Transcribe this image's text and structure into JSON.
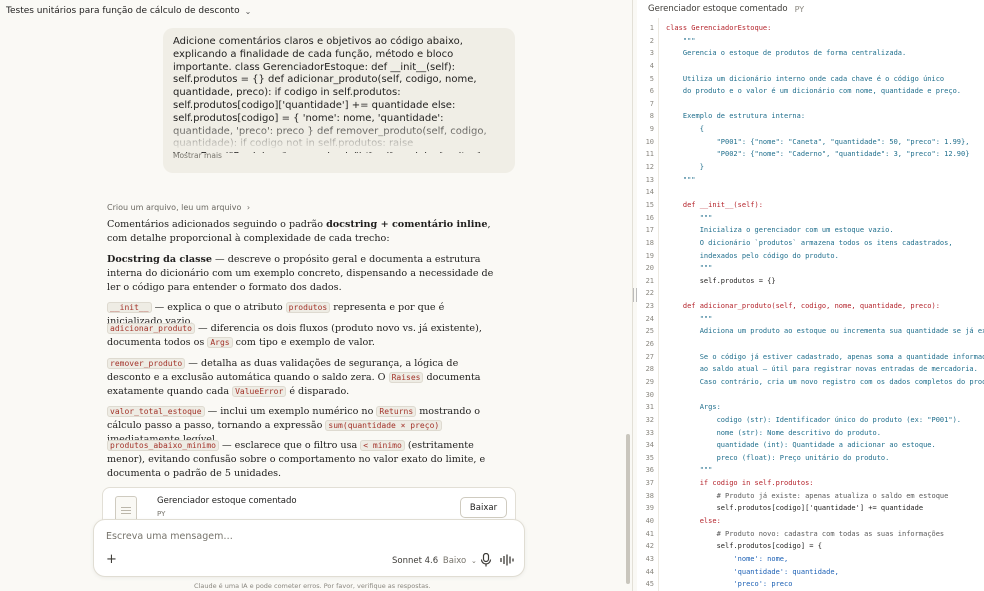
{
  "chat": {
    "title": "Testes unitários para função de cálculo de desconto",
    "user_message": "Adicione comentários claros e objetivos ao código abaixo, explicando a finalidade de cada função, método e bloco importante. class GerenciadorEstoque: def __init__(self): self.produtos = {} def adicionar_produto(self, codigo, nome, quantidade, preco): if codigo in self.produtos: self.produtos[codigo]['quantidade'] += quantidade else: self.produtos[codigo] = { 'nome': nome, 'quantidade': quantidade, 'preco': preco } def remover_produto(self, codigo, quantidade): if codigo not in self.produtos: raise ValueError(\"Produto não encontrado\") if self.produtos[codigo]['quantidade'] < quantidade: raise ValueError(\"Estoque",
    "show_more": "Mostrar mais",
    "activity": "Criou um arquivo, leu um arquivo",
    "intro_pre": "Comentários adicionados seguindo o padrão ",
    "intro_bold": "docstring + comentário inline",
    "intro_post": ", com detalhe proporcional à complexidade de cada trecho:",
    "p1_bold": "Docstring da classe",
    "p1_rest": " — descreve o propósito geral e documenta a estrutura interna do dicionário com um exemplo concreto, dispensando a necessidade de ler o código para entender o formato dos dados.",
    "p2_code": "__init__",
    "p2_mid": " — explica o que o atributo ",
    "p2_code2": "produtos",
    "p2_rest": " representa e por que é inicializado vazio.",
    "p3_code": "adicionar_produto",
    "p3_mid": " — diferencia os dois fluxos (produto novo vs. já existente), documenta todos os ",
    "p3_code2": "Args",
    "p3_rest": " com tipo e exemplo de valor.",
    "p4_code": "remover_produto",
    "p4_mid": " — detalha as duas validações de segurança, a lógica de desconto e a exclusão automática quando o saldo zera. O ",
    "p4_code2": "Raises",
    "p4_mid2": " documenta exatamente quando cada ",
    "p4_code3": "ValueError",
    "p4_rest": " é disparado.",
    "p5_code": "valor_total_estoque",
    "p5_mid": " — inclui um exemplo numérico no ",
    "p5_code2": "Returns",
    "p5_mid2": " mostrando o cálculo passo a passo, tornando a expressão ",
    "p5_code3": "sum(quantidade × preço)",
    "p5_rest": " imediatamente legível.",
    "p6_code": "produtos_abaixo_minimo",
    "p6_mid": " — esclarece que o filtro usa ",
    "p6_code2": "< minimo",
    "p6_rest": " (estritamente menor), evitando confusão sobre o comportamento no valor exato do limite, e documenta o padrão de 5 unidades.",
    "artifact_name": "Gerenciador estoque comentado",
    "artifact_type": "PY",
    "download": "Baixar",
    "composer_placeholder": "Escreva uma mensagem…",
    "plus": "+",
    "model": "Sonnet 4.6",
    "effort": "Baixo",
    "disclaimer": "Claude é uma IA e pode cometer erros. Por favor, verifique as respostas."
  },
  "code_panel": {
    "title": "Gerenciador estoque comentado",
    "type": "PY",
    "lines": [
      "class GerenciadorEstoque:",
      "    \"\"\"",
      "    Gerencia o estoque de produtos de forma centralizada.",
      "",
      "    Utiliza um dicionário interno onde cada chave é o código único",
      "    do produto e o valor é um dicionário com nome, quantidade e preço.",
      "",
      "    Exemplo de estrutura interna:",
      "        {",
      "            \"P001\": {\"nome\": \"Caneta\", \"quantidade\": 50, \"preco\": 1.99},",
      "            \"P002\": {\"nome\": \"Caderno\", \"quantidade\": 3, \"preco\": 12.90}",
      "        }",
      "    \"\"\"",
      "",
      "    def __init__(self):",
      "        \"\"\"",
      "        Inicializa o gerenciador com um estoque vazio.",
      "        O dicionário `produtos` armazena todos os itens cadastrados,",
      "        indexados pelo código do produto.",
      "        \"\"\"",
      "        self.produtos = {}",
      "",
      "    def adicionar_produto(self, codigo, nome, quantidade, preco):",
      "        \"\"\"",
      "        Adiciona um produto ao estoque ou incrementa sua quantidade se já existir.",
      "",
      "        Se o código já estiver cadastrado, apenas soma a quantidade informada",
      "        ao saldo atual — útil para registrar novas entradas de mercadoria.",
      "        Caso contrário, cria um novo registro com os dados completos do produto.",
      "",
      "        Args:",
      "            codigo (str): Identificador único do produto (ex: \"P001\").",
      "            nome (str): Nome descritivo do produto.",
      "            quantidade (int): Quantidade a adicionar ao estoque.",
      "            preco (float): Preço unitário do produto.",
      "        \"\"\"",
      "        if codigo in self.produtos:",
      "            # Produto já existe: apenas atualiza o saldo em estoque",
      "            self.produtos[codigo]['quantidade'] += quantidade",
      "        else:",
      "            # Produto novo: cadastra com todas as suas informações",
      "            self.produtos[codigo] = {",
      "                'nome': nome,",
      "                'quantidade': quantidade,",
      "                'preco': preco"
    ]
  }
}
